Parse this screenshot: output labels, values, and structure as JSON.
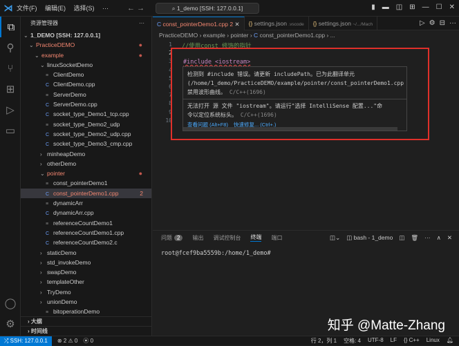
{
  "titlebar": {
    "menus": [
      "文件(F)",
      "编辑(E)",
      "选择(S)",
      "···"
    ],
    "search": "1_demo [SSH: 127.0.0.1]"
  },
  "sidebar": {
    "title": "资源管理器",
    "more": "···",
    "items": [
      {
        "label": "1_DEMO [SSH: 127.0.0.1]",
        "level": 0,
        "type": "open",
        "bold": true
      },
      {
        "label": "PracticeDEMO",
        "level": 1,
        "type": "open",
        "red": true,
        "dot": true
      },
      {
        "label": "example",
        "level": 2,
        "type": "open",
        "red": true,
        "dot": true
      },
      {
        "label": "linuxSocketDemo",
        "level": 3,
        "type": "open"
      },
      {
        "label": "ClientDemo",
        "level": 4,
        "type": "file"
      },
      {
        "label": "ClientDemo.cpp",
        "level": 4,
        "type": "cpp"
      },
      {
        "label": "ServerDemo",
        "level": 4,
        "type": "file"
      },
      {
        "label": "ServerDemo.cpp",
        "level": 4,
        "type": "cpp"
      },
      {
        "label": "socket_type_Demo1_tcp.cpp",
        "level": 4,
        "type": "cpp"
      },
      {
        "label": "socket_type_Demo2_udp",
        "level": 4,
        "type": "file"
      },
      {
        "label": "socket_type_Demo2_udp.cpp",
        "level": 4,
        "type": "cpp"
      },
      {
        "label": "socket_type_Demo3_cmp.cpp",
        "level": 4,
        "type": "cpp"
      },
      {
        "label": "minheapDemo",
        "level": 3,
        "type": "closed"
      },
      {
        "label": "otherDemo",
        "level": 3,
        "type": "closed"
      },
      {
        "label": "pointer",
        "level": 3,
        "type": "open",
        "red": true,
        "dot": true
      },
      {
        "label": "const_pointerDemo1",
        "level": 4,
        "type": "file"
      },
      {
        "label": "const_pointerDemo1.cpp",
        "level": 4,
        "type": "cpp",
        "red": true,
        "selected": true,
        "badge": "2"
      },
      {
        "label": "dynamicArr",
        "level": 4,
        "type": "file"
      },
      {
        "label": "dynamicArr.cpp",
        "level": 4,
        "type": "cpp"
      },
      {
        "label": "referenceCountDemo1",
        "level": 4,
        "type": "file"
      },
      {
        "label": "referenceCountDemo1.cpp",
        "level": 4,
        "type": "cpp"
      },
      {
        "label": "referenceCountDemo2.c",
        "level": 4,
        "type": "cpp"
      },
      {
        "label": "staticDemo",
        "level": 3,
        "type": "closed"
      },
      {
        "label": "std_invokeDemo",
        "level": 3,
        "type": "closed"
      },
      {
        "label": "swapDemo",
        "level": 3,
        "type": "closed"
      },
      {
        "label": "templateOther",
        "level": 3,
        "type": "closed"
      },
      {
        "label": "TryDemo",
        "level": 3,
        "type": "closed"
      },
      {
        "label": "unionDemo",
        "level": 3,
        "type": "closed"
      },
      {
        "label": "bitoperationDemo",
        "level": 4,
        "type": "file"
      }
    ],
    "outline": "大纲",
    "timeline": "时间线"
  },
  "tabs": [
    {
      "label": "const_pointerDemo1.cpp",
      "badge": "2"
    },
    {
      "label": "settings.json",
      "hint": ".vscode"
    },
    {
      "label": "settings.json",
      "hint": "~/.../Mach"
    }
  ],
  "breadcrumb": [
    "PracticeDEMO",
    "example",
    "pointer",
    "const_pointerDemo1.cpp",
    "..."
  ],
  "editor": {
    "line_numbers": [
      "1",
      "2",
      "3",
      "4",
      "5",
      "6",
      "7",
      "8",
      "9",
      "10"
    ],
    "line1": "//使用const 修饰的指针",
    "include": "#include <iostream>"
  },
  "hover": {
    "msg1_l1": "检测到 #include 错误。请更新 includePath。已为此翻译单元",
    "msg1_l2": "(/home/1_demo/PracticeDEMO/example/pointer/const_pointerDemo1.cpp",
    "msg1_l3": "禁用波形曲线。",
    "msg1_src": "C/C++(1696)",
    "msg2_l1": "无法打开 源 文件 \"iostream\"。请运行\"选择 IntelliSense 配置...\"命",
    "msg2_l2": "令以定位系统标头。",
    "msg2_src": "C/C++(1696)",
    "view_problem": "查看问题 (Alt+F8)",
    "quick_fix": "快速修复... (Ctrl+.)"
  },
  "panel": {
    "tabs": [
      "问题",
      "输出",
      "调试控制台",
      "终端",
      "端口"
    ],
    "problems_count": "2",
    "terminal_name": "bash - 1_demo",
    "prompt": "root@fcef9ba5559b:/home/1_demo#"
  },
  "watermark": "知乎 @Matte-Zhang",
  "status": {
    "remote": "SSH: 127.0.0.1",
    "errors": "2",
    "warnings": "0",
    "ports": "0",
    "position": "行 2，列 1",
    "spaces": "空格: 4",
    "encoding": "UTF-8",
    "eol": "LF",
    "language": "C++",
    "platform": "Linux"
  }
}
